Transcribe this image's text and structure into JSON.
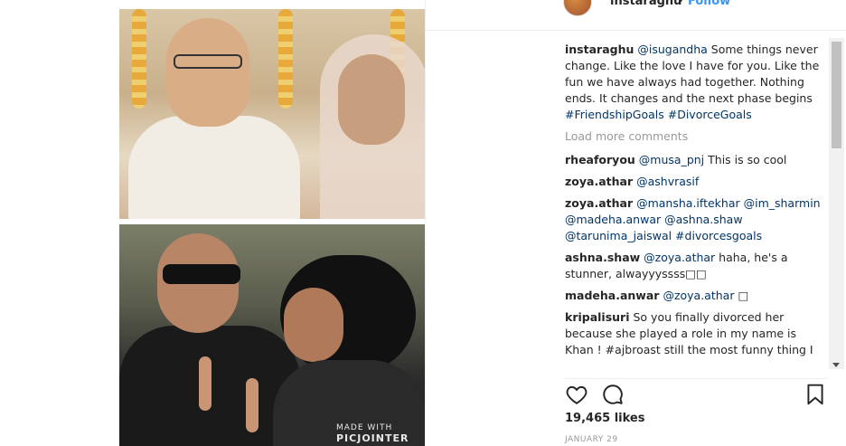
{
  "header": {
    "username": "instaraghu",
    "separator": "•",
    "follow_label": "Follow"
  },
  "photo": {
    "watermark_line1": "MADE WITH",
    "watermark_line2": "PICJOINTER"
  },
  "caption": {
    "username": "instaraghu",
    "mention": "@isugandha",
    "text": " Some things never change. Like the love I have for you. Like the fun we have always had together. Nothing ends. It changes and the next phase begins ",
    "hashtag1": "#FriendshipGoals",
    "hashtag2": "#DivorceGoals"
  },
  "load_more": "Load more comments",
  "comments": [
    {
      "user": "rheaforyou",
      "mention": "@musa_pnj",
      "text": " This is so cool"
    },
    {
      "user": "zoya.athar",
      "mention": "@ashvrasif",
      "text": ""
    },
    {
      "user": "zoya.athar",
      "mention": "@mansha.iftekhar @im_sharmin @madeha.anwar @ashna.shaw @tarunima_jaiswal #divorcesgoals",
      "text": ""
    },
    {
      "user": "ashna.shaw",
      "mention": "@zoya.athar",
      "text": " haha, he's a stunner, alwayyyssss□□"
    },
    {
      "user": "madeha.anwar",
      "mention": "@zoya.athar",
      "text": " □"
    },
    {
      "user": "kripalisuri",
      "mention": "",
      "text": " So you finally divorced her because she played a role in my name is Khan ! #ajbroast still the most funny thing I"
    }
  ],
  "likes": "19,465 likes",
  "date": "JANUARY 29",
  "icons": {
    "like": "heart-icon",
    "comment": "comment-bubble-icon",
    "save": "bookmark-icon"
  }
}
